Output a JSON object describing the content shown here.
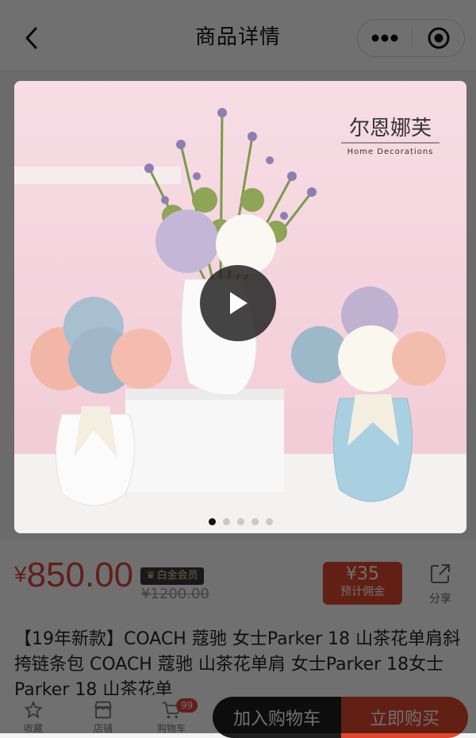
{
  "header": {
    "title": "商品详情"
  },
  "gallery": {
    "brand_cn": "尔恩娜芙",
    "brand_en": "Home Decorations",
    "slide_count": 5,
    "active_slide": 1
  },
  "price": {
    "symbol": "¥",
    "value": "850.00",
    "original": "¥1200.00",
    "vip_badge": "白金会员"
  },
  "commission": {
    "amount": "¥35",
    "label": "预计佣金"
  },
  "share": {
    "label": "分享"
  },
  "description": "【19年新款】COACH 蔻驰 女士Parker 18 山茶花单肩斜挎链条包 COACH 蔻驰  山茶花单肩 女士Parker 18女士Parker 18 山茶花单",
  "bottom_bar": {
    "nav": [
      {
        "label": "收藏",
        "icon": "star-icon"
      },
      {
        "label": "店铺",
        "icon": "shop-icon"
      },
      {
        "label": "购物车",
        "icon": "cart-icon"
      }
    ],
    "cart_count": "99",
    "add_cart": "加入购物车",
    "buy_now": "立即购买"
  },
  "colors": {
    "accent": "#e0472f",
    "dark_button": "#1f1f1f"
  }
}
